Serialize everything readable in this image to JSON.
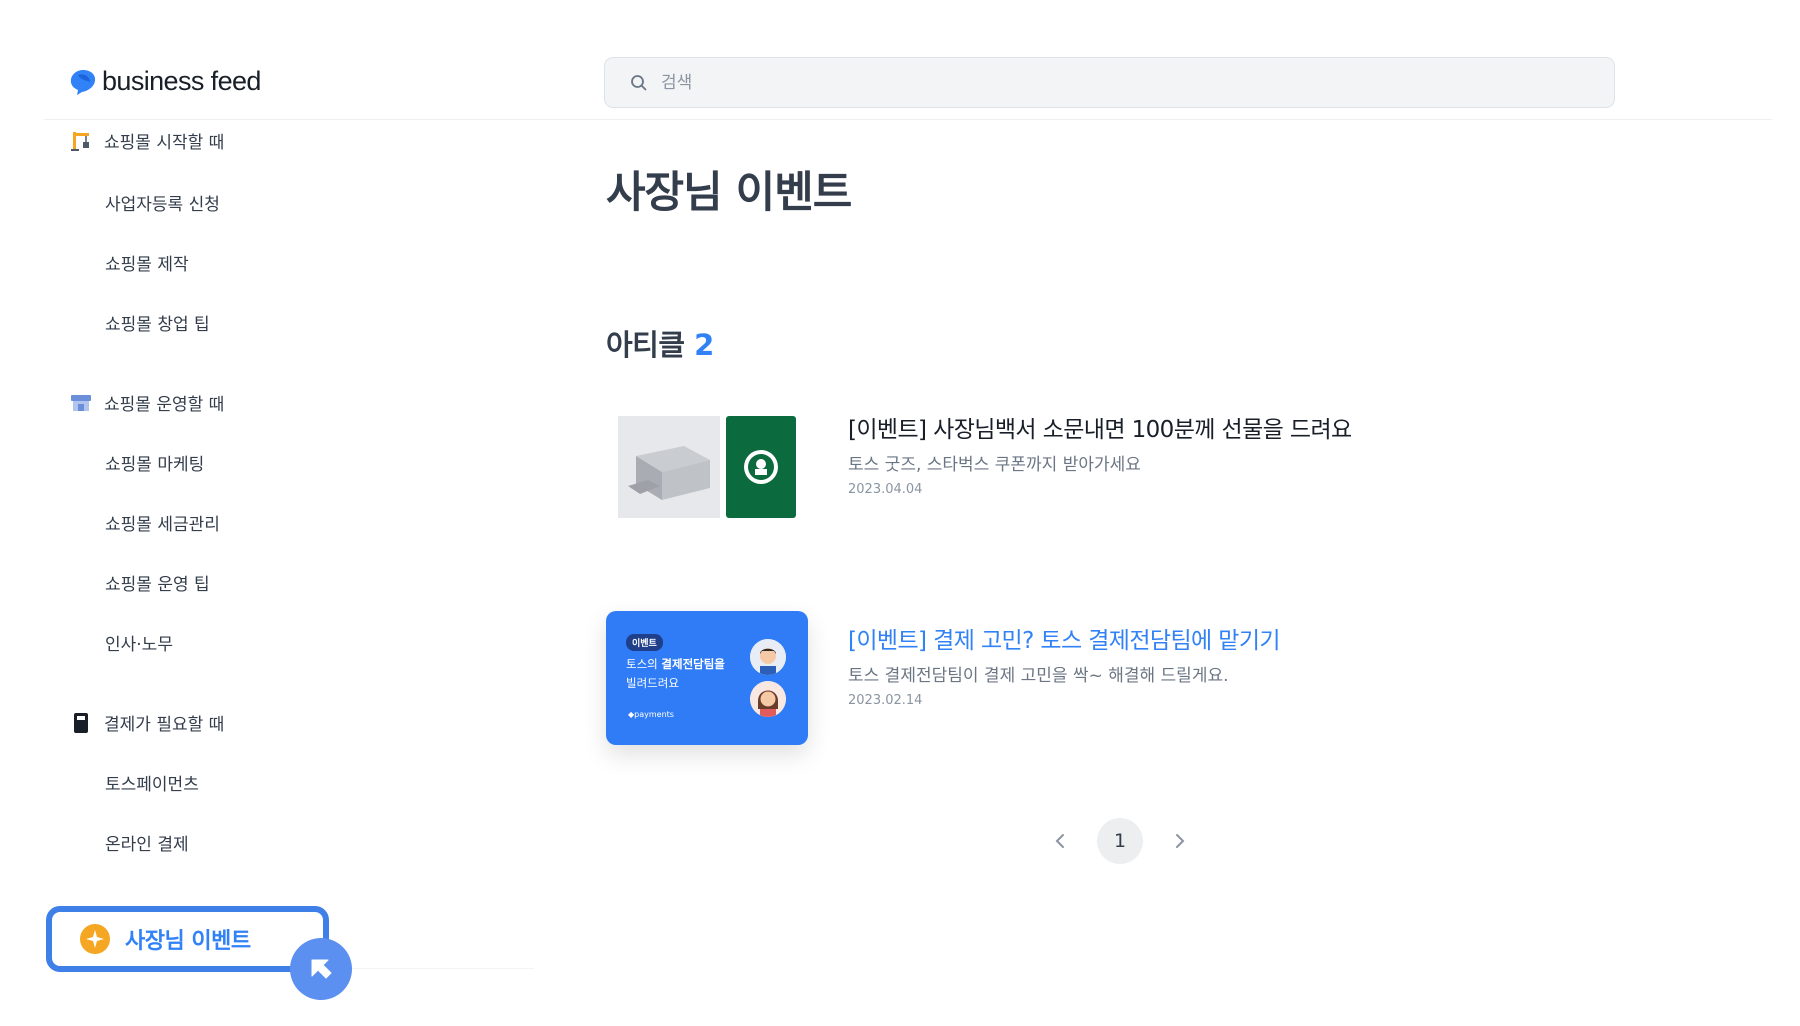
{
  "brand": {
    "name": "business feed",
    "accent": "#3182f6"
  },
  "search": {
    "placeholder": "검색",
    "icon": "search-icon"
  },
  "sidebar": {
    "groups": [
      {
        "label": "쇼핑몰 시작할 때",
        "icon": "crane-icon",
        "items": [
          "사업자등록 신청",
          "쇼핑몰 제작",
          "쇼핑몰 창업 팁"
        ]
      },
      {
        "label": "쇼핑몰 운영할 때",
        "icon": "store-icon",
        "items": [
          "쇼핑몰 마케팅",
          "쇼핑몰 세금관리",
          "쇼핑몰 운영 팁",
          "인사·노무"
        ]
      },
      {
        "label": "결제가 필요할 때",
        "icon": "terminal-icon",
        "items": [
          "토스페이먼츠",
          "온라인 결제"
        ]
      }
    ],
    "active": {
      "label": "사장님 이벤트",
      "icon": "star-icon"
    }
  },
  "main": {
    "title": "사장님 이벤트",
    "section_label": "아티클",
    "section_count": "2",
    "articles": [
      {
        "title": "[이벤트] 사장님백서 소문내면 100분께 선물을 드려요",
        "description": "토스 굿즈, 스타벅스 쿠폰까지 받아가세요",
        "date": "2023.04.04"
      },
      {
        "title": "[이벤트] 결제 고민? 토스 결제전담팀에 맡기기",
        "description": "토스 결제전담팀이 결제 고민을 싹~ 해결해 드릴게요.",
        "date": "2023.02.14",
        "thumb": {
          "tag": "이벤트",
          "line1_plain": "토스의 ",
          "line1_bold": "결제전담팀을",
          "line2": "빌려드려요",
          "brand": "◆payments"
        }
      }
    ]
  },
  "pagination": {
    "current": "1"
  }
}
